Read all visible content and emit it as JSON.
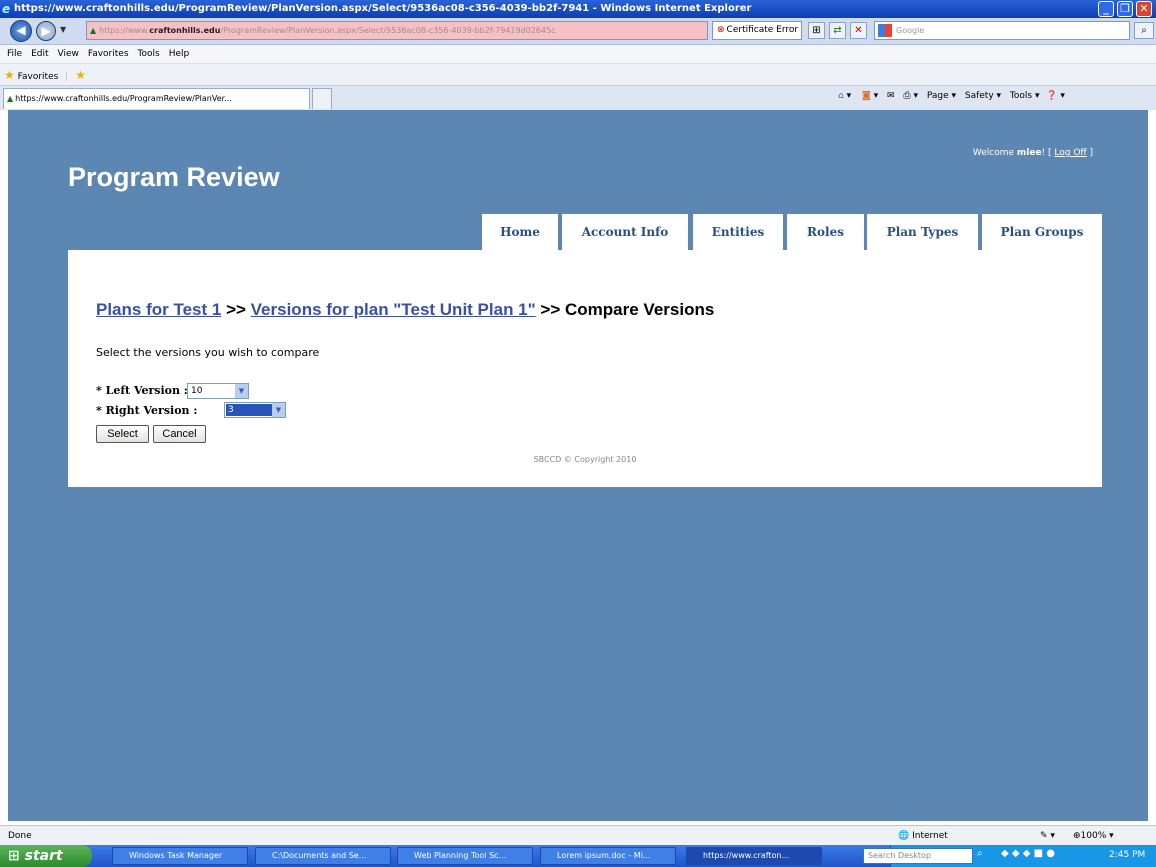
{
  "window": {
    "title": "https://www.craftonhills.edu/ProgramReview/PlanVersion.aspx/Select/9536ac08-c356-4039-bb2f-7941 - Windows Internet Explorer"
  },
  "browser": {
    "address_faded_1": "https://www.",
    "address_domain": "craftonhills.edu",
    "address_faded_2": "/ProgramReview/PlanVersion.aspx/Select/9536ac08-c356-4039-bb2f-79419d02645c",
    "cert_error": "Certificate Error",
    "search_placeholder": "Google",
    "menu": [
      "File",
      "Edit",
      "View",
      "Favorites",
      "Tools",
      "Help"
    ],
    "favorites_label": "Favorites",
    "tab_label": "https://www.craftonhills.edu/ProgramReview/PlanVer...",
    "cmd_page": "Page",
    "cmd_safety": "Safety",
    "cmd_tools": "Tools",
    "status_left": "Done",
    "zone": "Internet",
    "zoom": "100%"
  },
  "site": {
    "welcome_prefix": "Welcome ",
    "username": "mlee",
    "welcome_suffix": "! [ ",
    "logoff": "Log Off",
    "welcome_close": " ]",
    "brand": "Program Review",
    "nav": [
      "Home",
      "Account Info",
      "Entities",
      "Roles",
      "Plan Types",
      "Plan Groups"
    ]
  },
  "content": {
    "crumb1": "Plans for Test 1",
    "sep1": " >> ",
    "crumb2": "Versions for plan \"Test Unit Plan 1\"",
    "sep2": " >> Compare Versions",
    "instructions": "Select the versions you wish to compare",
    "left_label": "* Left Version :",
    "left_value": "10",
    "right_label": "* Right Version :",
    "right_value": "3",
    "select_btn": "Select",
    "cancel_btn": "Cancel",
    "copyright": "SBCCD © Copyright 2010"
  },
  "taskbar": {
    "start": "start",
    "tasks": [
      "Windows Task Manager",
      "C:\\Documents and Se...",
      "Web Planning Tool Sc...",
      "Lorem ipsum.doc - Mi...",
      "https://www.crafton..."
    ],
    "search": "Search Desktop",
    "clock": "2:45 PM"
  }
}
